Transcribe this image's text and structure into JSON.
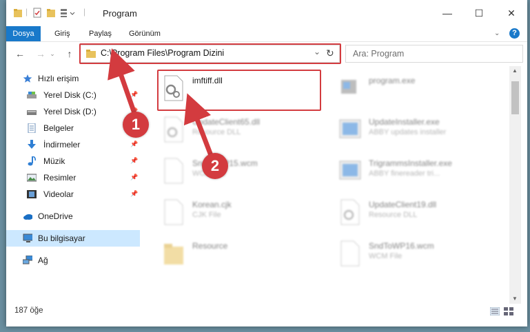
{
  "window": {
    "title": "Program",
    "minimize": "—",
    "maximize": "☐",
    "close": "✕"
  },
  "ribbon": {
    "tabs": [
      "Dosya",
      "Giriş",
      "Paylaş",
      "Görünüm"
    ],
    "help": "?"
  },
  "nav": {
    "back": "←",
    "forward": "→",
    "up": "↑",
    "address": "C:\\Program Files\\Program Dizini",
    "search_placeholder": "Ara: Program"
  },
  "sidebar": {
    "items": [
      {
        "label": "Hızlı erişim",
        "icon": "star-icon"
      },
      {
        "label": "Yerel Disk (C:)",
        "icon": "drive-icon"
      },
      {
        "label": "Yerel Disk (D:)",
        "icon": "drive-icon"
      },
      {
        "label": "Belgeler",
        "icon": "documents-icon"
      },
      {
        "label": "İndirmeler",
        "icon": "download-icon"
      },
      {
        "label": "Müzik",
        "icon": "music-icon"
      },
      {
        "label": "Resimler",
        "icon": "pictures-icon"
      },
      {
        "label": "Videolar",
        "icon": "video-icon"
      },
      {
        "label": "OneDrive",
        "icon": "cloud-icon"
      },
      {
        "label": "Bu bilgisayar",
        "icon": "computer-icon"
      },
      {
        "label": "Ağ",
        "icon": "network-icon"
      }
    ]
  },
  "files": [
    {
      "name": "imftiff.dll",
      "type": ""
    },
    {
      "name": "program.exe",
      "type": ""
    },
    {
      "name": "UpdateClient65.dll",
      "type": "Resource DLL"
    },
    {
      "name": "UpdateInstaller.exe",
      "type": "ABBY updates installer"
    },
    {
      "name": "SndToWP15.wcm",
      "type": "WCM File"
    },
    {
      "name": "TrigrammsInstaller.exe",
      "type": "ABBY finereader tri..."
    },
    {
      "name": "Korean.cjk",
      "type": "CJK File"
    },
    {
      "name": "UpdateClient19.dll",
      "type": "Resource DLL"
    },
    {
      "name": "Resource",
      "type": ""
    },
    {
      "name": "SndToWP16.wcm",
      "type": "WCM File"
    }
  ],
  "status": {
    "count": "187 öğe"
  },
  "annotations": {
    "badge1": "1",
    "badge2": "2",
    "color": "#d33b3f"
  }
}
